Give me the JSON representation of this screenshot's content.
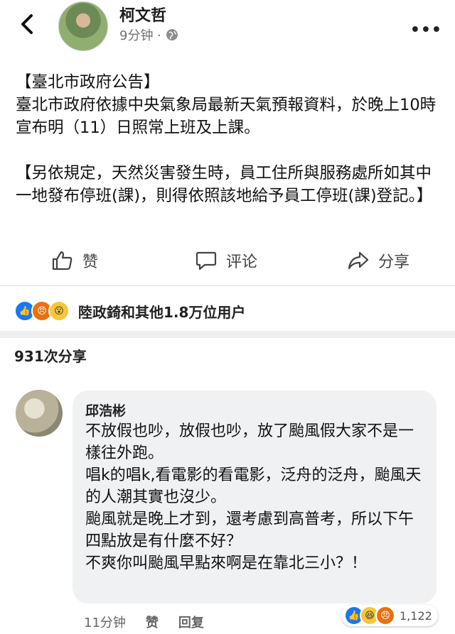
{
  "header": {
    "author": "柯文哲",
    "time": "9分钟 ·",
    "more": "•••"
  },
  "post": {
    "paragraphs": [
      "【臺北市政府公告】",
      "臺北市政府依據中央氣象局最新天氣預報資料，於晚上10時宣布明（11）日照常上班及上課。",
      "【另依規定，天然災害發生時，員工住所與服務處所如其中一地發布停班(課)，則得依照該地給予員工停班(課)登記。】"
    ]
  },
  "actions": {
    "like": "赞",
    "comment": "评论",
    "share": "分享"
  },
  "reactions": {
    "text": "陸政錡和其他1.8万位用户"
  },
  "shares": "931次分享",
  "comment": {
    "name": "邱浩彬",
    "lines": [
      "不放假也吵，放假也吵，放了颱風假大家不是一樣往外跑。",
      "唱k的唱k,看電影的看電影，泛舟的泛舟，颱風天的人潮其實也沒少。",
      "颱風就是晚上才到，還考慮到高普考，所以下午四點放是有什麼不好？",
      "不爽你叫颱風早點來啊是在靠北三小？！"
    ],
    "time": "11分钟",
    "like": "赞",
    "reply": "回复",
    "reaction_count": "1,122"
  },
  "colors": {
    "like_blue": "#1877f2",
    "angry_orange": "#e9710f",
    "wow_yellow": "#f7c73b",
    "bubble_bg": "#eff1f3"
  }
}
